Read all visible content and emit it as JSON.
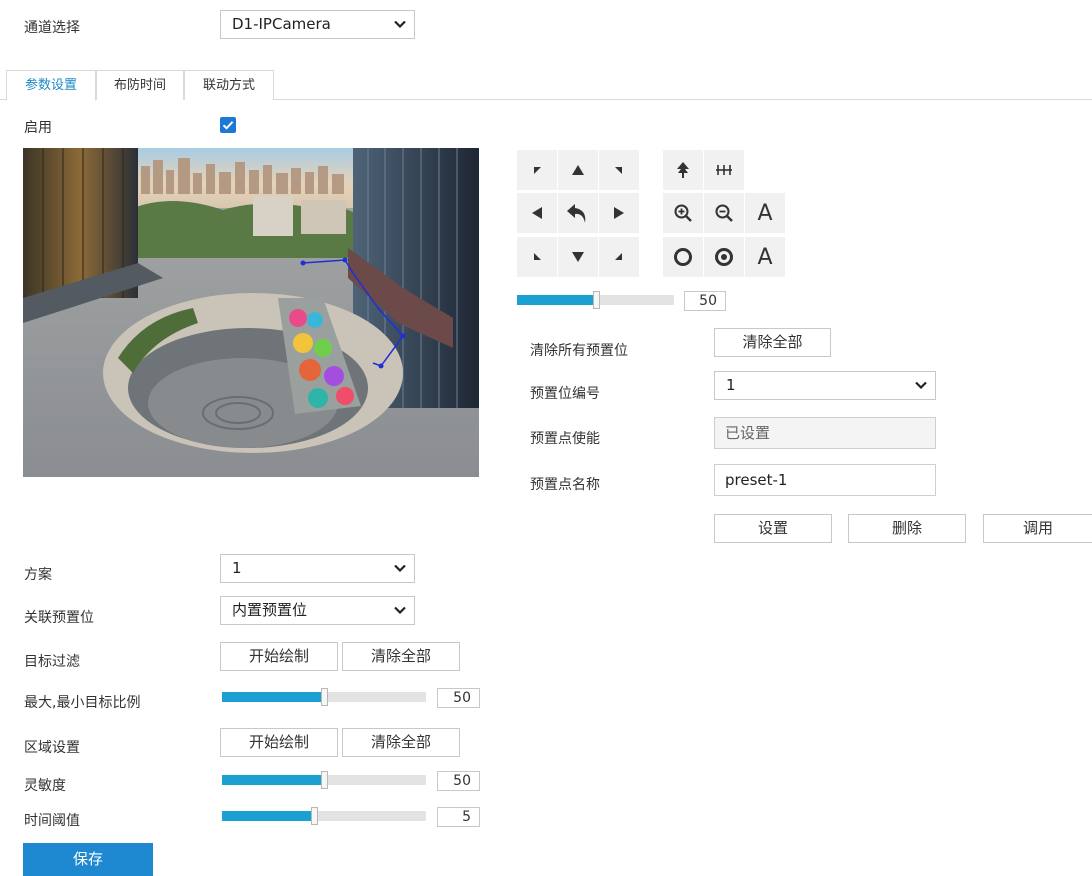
{
  "channel": {
    "label": "通道选择",
    "value": "D1-IPCamera"
  },
  "tabs": [
    {
      "label": "参数设置",
      "active": true
    },
    {
      "label": "布防时间",
      "active": false
    },
    {
      "label": "联动方式",
      "active": false
    }
  ],
  "enable": {
    "label": "启用",
    "checked": true
  },
  "ptz": {
    "buttons": [
      "up-left-arrow",
      "up-arrow",
      "up-right-arrow",
      "fan-icon",
      "wiper-icon",
      "left-arrow",
      "return-icon",
      "right-arrow",
      "zoom-in-icon",
      "zoom-out-icon",
      "auto-focus",
      "down-left-arrow",
      "down-arrow",
      "down-right-arrow",
      "iris-open-icon",
      "iris-close-icon",
      "auto-iris"
    ],
    "letter_a_focus": "A",
    "letter_a_iris": "A",
    "speed_value": "50",
    "speed_fraction": 0.5
  },
  "preset": {
    "clear_all_label": "清除所有预置位",
    "clear_all_button": "清除全部",
    "number_label": "预置位编号",
    "number_value": "1",
    "enable_label": "预置点使能",
    "enable_value": "已设置",
    "name_label": "预置点名称",
    "name_value": "preset-1",
    "set_button": "设置",
    "delete_button": "删除",
    "call_button": "调用"
  },
  "form": {
    "plan_label": "方案",
    "plan_value": "1",
    "linked_preset_label": "关联预置位",
    "linked_preset_value": "内置预置位",
    "target_filter_label": "目标过滤",
    "start_draw_button": "开始绘制",
    "clear_all_button": "清除全部",
    "ratio_label": "最大,最小目标比例",
    "ratio_value": "50",
    "ratio_fraction": 0.5,
    "area_label": "区域设置",
    "area_start_button": "开始绘制",
    "area_clear_button": "清除全部",
    "sensitivity_label": "灵敏度",
    "sensitivity_value": "50",
    "sensitivity_fraction": 0.5,
    "time_threshold_label": "时间阈值",
    "time_threshold_value": "5",
    "time_threshold_fraction": 0.45
  },
  "save_button": "保存",
  "colors": {
    "accent": "#1e88d0",
    "slider": "#1c9fd1",
    "tab_active": "#1e88c7",
    "region": "#1f2fd8"
  }
}
